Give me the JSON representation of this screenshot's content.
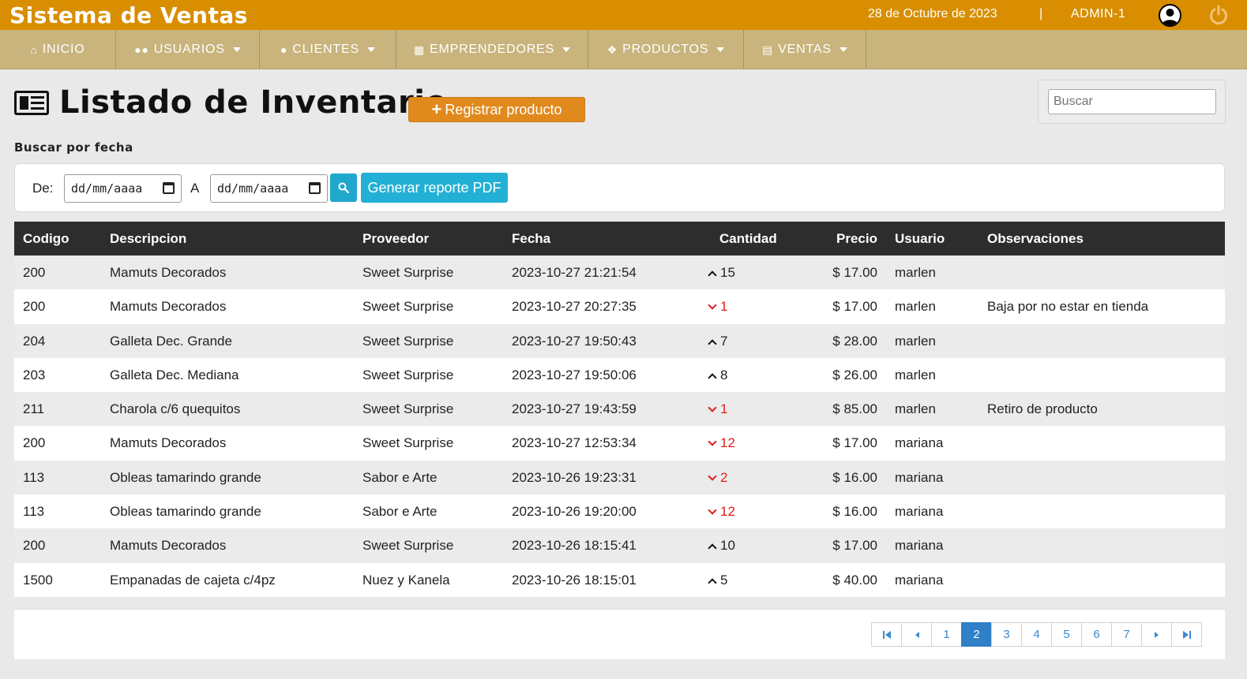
{
  "app": {
    "title": "Sistema de Ventas",
    "date": "28 de Octubre de 2023",
    "separator": "|",
    "user": "ADMIN-1"
  },
  "colors": {
    "topbar": "#d88e00",
    "nav": "#c8b47c",
    "register_btn": "#e08a1e",
    "pdf_btn": "#22b0d4",
    "qty_down": "#e01b1b"
  },
  "nav": {
    "inicio": "INICIO",
    "usuarios": "USUARIOS",
    "clientes": "CLIENTES",
    "emprendedores": "EMPRENDEDORES",
    "productos": "PRODUCTOS",
    "ventas": "VENTAS"
  },
  "page": {
    "title": "Listado de Inventario",
    "register_label": "Registrar producto",
    "search_placeholder": "Buscar",
    "filter_label": "Buscar por fecha",
    "from_label": "De:",
    "to_label": "A",
    "date_placeholder": "dd/mm/aaaa",
    "pdf_label": "Generar reporte PDF"
  },
  "table": {
    "headers": {
      "codigo": "Codigo",
      "descripcion": "Descripcion",
      "proveedor": "Proveedor",
      "fecha": "Fecha",
      "cantidad": "Cantidad",
      "precio": "Precio",
      "usuario": "Usuario",
      "observaciones": "Observaciones"
    },
    "rows": [
      {
        "codigo": "200",
        "descripcion": "Mamuts Decorados",
        "proveedor": "Sweet Surprise",
        "fecha": "2023-10-27 21:21:54",
        "dir": "up",
        "cantidad": "15",
        "precio": "$ 17.00",
        "usuario": "marlen",
        "observaciones": ""
      },
      {
        "codigo": "200",
        "descripcion": "Mamuts Decorados",
        "proveedor": "Sweet Surprise",
        "fecha": "2023-10-27 20:27:35",
        "dir": "down",
        "cantidad": "1",
        "precio": "$ 17.00",
        "usuario": "marlen",
        "observaciones": "Baja por no estar en tienda"
      },
      {
        "codigo": "204",
        "descripcion": "Galleta Dec. Grande",
        "proveedor": "Sweet Surprise",
        "fecha": "2023-10-27 19:50:43",
        "dir": "up",
        "cantidad": "7",
        "precio": "$ 28.00",
        "usuario": "marlen",
        "observaciones": ""
      },
      {
        "codigo": "203",
        "descripcion": "Galleta Dec. Mediana",
        "proveedor": "Sweet Surprise",
        "fecha": "2023-10-27 19:50:06",
        "dir": "up",
        "cantidad": "8",
        "precio": "$ 26.00",
        "usuario": "marlen",
        "observaciones": ""
      },
      {
        "codigo": "211",
        "descripcion": "Charola c/6 quequitos",
        "proveedor": "Sweet Surprise",
        "fecha": "2023-10-27 19:43:59",
        "dir": "down",
        "cantidad": "1",
        "precio": "$ 85.00",
        "usuario": "marlen",
        "observaciones": "Retiro de producto"
      },
      {
        "codigo": "200",
        "descripcion": "Mamuts Decorados",
        "proveedor": "Sweet Surprise",
        "fecha": "2023-10-27 12:53:34",
        "dir": "down",
        "cantidad": "12",
        "precio": "$ 17.00",
        "usuario": "mariana",
        "observaciones": ""
      },
      {
        "codigo": "113",
        "descripcion": "Obleas tamarindo grande",
        "proveedor": "Sabor e Arte",
        "fecha": "2023-10-26 19:23:31",
        "dir": "down",
        "cantidad": "2",
        "precio": "$ 16.00",
        "usuario": "mariana",
        "observaciones": ""
      },
      {
        "codigo": "113",
        "descripcion": "Obleas tamarindo grande",
        "proveedor": "Sabor e Arte",
        "fecha": "2023-10-26 19:20:00",
        "dir": "down",
        "cantidad": "12",
        "precio": "$ 16.00",
        "usuario": "mariana",
        "observaciones": ""
      },
      {
        "codigo": "200",
        "descripcion": "Mamuts Decorados",
        "proveedor": "Sweet Surprise",
        "fecha": "2023-10-26 18:15:41",
        "dir": "up",
        "cantidad": "10",
        "precio": "$ 17.00",
        "usuario": "mariana",
        "observaciones": ""
      },
      {
        "codigo": "1500",
        "descripcion": "Empanadas de cajeta c/4pz",
        "proveedor": "Nuez y Kanela",
        "fecha": "2023-10-26 18:15:01",
        "dir": "up",
        "cantidad": "5",
        "precio": "$ 40.00",
        "usuario": "mariana",
        "observaciones": ""
      }
    ]
  },
  "pagination": {
    "pages": [
      "1",
      "2",
      "3",
      "4",
      "5",
      "6",
      "7"
    ],
    "current": "2",
    "icons": {
      "first": "first-page-icon",
      "prev": "prev-page-icon",
      "next": "next-page-icon",
      "last": "last-page-icon"
    }
  }
}
